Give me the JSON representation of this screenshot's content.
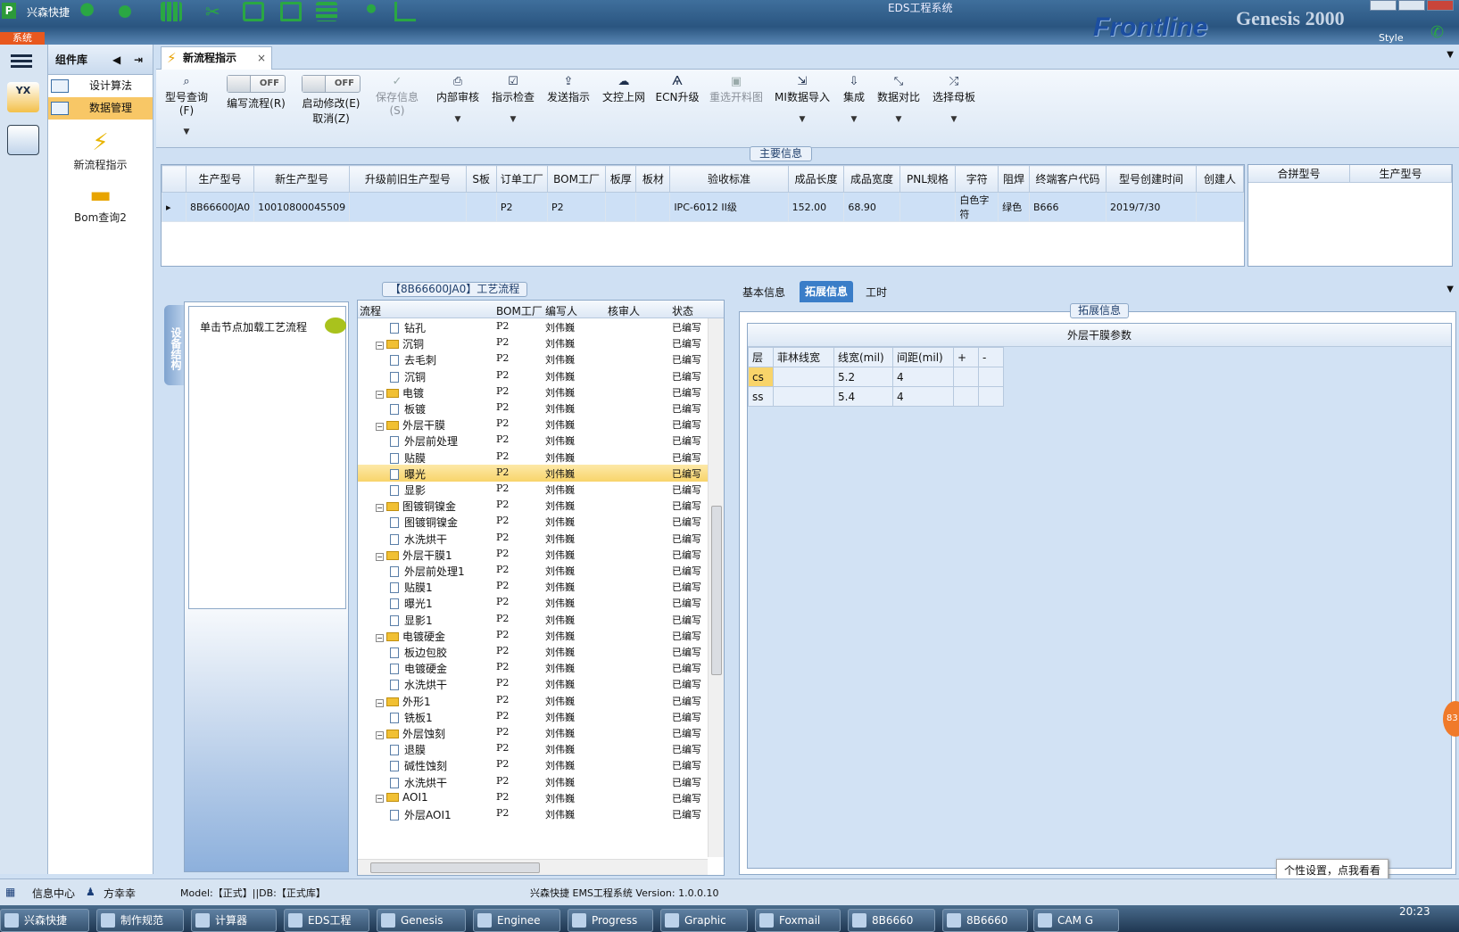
{
  "title": {
    "app_name": "兴森快捷",
    "window_title": "EDS工程系统",
    "brand": "Frontline",
    "brand2": "Genesis 2000",
    "style_label": "Style"
  },
  "system_button": "系统",
  "component_panel": {
    "header": "组件库",
    "items": [
      {
        "label": "设计算法"
      },
      {
        "label": "数据管理"
      }
    ],
    "big_items": [
      {
        "label": "新流程指示",
        "icon": "lightning-icon"
      },
      {
        "label": "Bom查询2",
        "icon": "folder-icon"
      }
    ]
  },
  "tab": {
    "label": "新流程指示"
  },
  "toolbar": {
    "items": [
      {
        "label": "型号查询(F)",
        "icon": "search-icon"
      },
      {
        "label": "编写流程(R)",
        "toggle": "OFF"
      },
      {
        "label": "启动修改(E)",
        "toggle": "OFF",
        "sub": "取消(Z)"
      },
      {
        "label": "保存信息(S)",
        "icon": "check-icon"
      },
      {
        "label": "内部审核",
        "icon": "print-icon"
      },
      {
        "label": "指示检查",
        "icon": "checkbox-icon"
      },
      {
        "label": "发送指示",
        "icon": "upload-icon"
      },
      {
        "label": "文控上网",
        "icon": "cloud-icon"
      },
      {
        "label": "ECN升级",
        "icon": "ecn-icon"
      },
      {
        "label": "重选开料图",
        "icon": "image-icon"
      },
      {
        "label": "MI数据导入",
        "icon": "import-icon"
      },
      {
        "label": "集成",
        "icon": "download-icon"
      },
      {
        "label": "数据对比",
        "icon": "compare-icon"
      },
      {
        "label": "选择母板",
        "icon": "shuffle-icon"
      }
    ]
  },
  "main_info": {
    "caption": "主要信息",
    "columns": [
      "生产型号",
      "新生产型号",
      "升级前旧生产型号",
      "S板",
      "订单工厂",
      "BOM工厂",
      "板厚",
      "板材",
      "验收标准",
      "成品长度",
      "成品宽度",
      "PNL规格",
      "字符",
      "阻焊",
      "终端客户代码",
      "型号创建时间",
      "创建人"
    ],
    "rows": [
      [
        "8B66600JA0",
        "10010800045509",
        "",
        "",
        "P2",
        "P2",
        "",
        "",
        "IPC-6012 II级",
        "152.00",
        "68.90",
        "",
        "白色字符",
        "绿色",
        "B666",
        "2019/7/30",
        ""
      ]
    ],
    "merge_columns": [
      "合拼型号",
      "生产型号"
    ]
  },
  "process": {
    "caption": "【8B66600JA0】工艺流程",
    "side_tab": "设备结构",
    "hint": "单击节点加载工艺流程",
    "columns": [
      "流程",
      "BOM工厂",
      "编写人",
      "核审人",
      "状态"
    ],
    "rows": [
      {
        "name": "钻孔",
        "level": 2,
        "bom": "P2",
        "author": "刘伟巍",
        "status": "已编写"
      },
      {
        "name": "沉铜",
        "level": 1,
        "bom": "P2",
        "author": "刘伟巍",
        "status": "已编写"
      },
      {
        "name": "去毛刺",
        "level": 2,
        "bom": "P2",
        "author": "刘伟巍",
        "status": "已编写"
      },
      {
        "name": "沉铜",
        "level": 2,
        "bom": "P2",
        "author": "刘伟巍",
        "status": "已编写"
      },
      {
        "name": "电镀",
        "level": 1,
        "bom": "P2",
        "author": "刘伟巍",
        "status": "已编写"
      },
      {
        "name": "板镀",
        "level": 2,
        "bom": "P2",
        "author": "刘伟巍",
        "status": "已编写"
      },
      {
        "name": "外层干膜",
        "level": 1,
        "bom": "P2",
        "author": "刘伟巍",
        "status": "已编写"
      },
      {
        "name": "外层前处理",
        "level": 2,
        "bom": "P2",
        "author": "刘伟巍",
        "status": "已编写"
      },
      {
        "name": "贴膜",
        "level": 2,
        "bom": "P2",
        "author": "刘伟巍",
        "status": "已编写"
      },
      {
        "name": "曝光",
        "level": 2,
        "bom": "P2",
        "author": "刘伟巍",
        "status": "已编写",
        "selected": true
      },
      {
        "name": "显影",
        "level": 2,
        "bom": "P2",
        "author": "刘伟巍",
        "status": "已编写"
      },
      {
        "name": "图镀铜镍金",
        "level": 1,
        "bom": "P2",
        "author": "刘伟巍",
        "status": "已编写"
      },
      {
        "name": "图镀铜镍金",
        "level": 2,
        "bom": "P2",
        "author": "刘伟巍",
        "status": "已编写"
      },
      {
        "name": "水洗烘干",
        "level": 2,
        "bom": "P2",
        "author": "刘伟巍",
        "status": "已编写"
      },
      {
        "name": "外层干膜1",
        "level": 1,
        "bom": "P2",
        "author": "刘伟巍",
        "status": "已编写"
      },
      {
        "name": "外层前处理1",
        "level": 2,
        "bom": "P2",
        "author": "刘伟巍",
        "status": "已编写"
      },
      {
        "name": "贴膜1",
        "level": 2,
        "bom": "P2",
        "author": "刘伟巍",
        "status": "已编写"
      },
      {
        "name": "曝光1",
        "level": 2,
        "bom": "P2",
        "author": "刘伟巍",
        "status": "已编写"
      },
      {
        "name": "显影1",
        "level": 2,
        "bom": "P2",
        "author": "刘伟巍",
        "status": "已编写"
      },
      {
        "name": "电镀硬金",
        "level": 1,
        "bom": "P2",
        "author": "刘伟巍",
        "status": "已编写"
      },
      {
        "name": "板边包胶",
        "level": 2,
        "bom": "P2",
        "author": "刘伟巍",
        "status": "已编写"
      },
      {
        "name": "电镀硬金",
        "level": 2,
        "bom": "P2",
        "author": "刘伟巍",
        "status": "已编写"
      },
      {
        "name": "水洗烘干",
        "level": 2,
        "bom": "P2",
        "author": "刘伟巍",
        "status": "已编写"
      },
      {
        "name": "外形1",
        "level": 1,
        "bom": "P2",
        "author": "刘伟巍",
        "status": "已编写"
      },
      {
        "name": "铣板1",
        "level": 2,
        "bom": "P2",
        "author": "刘伟巍",
        "status": "已编写"
      },
      {
        "name": "外层蚀刻",
        "level": 1,
        "bom": "P2",
        "author": "刘伟巍",
        "status": "已编写"
      },
      {
        "name": "退膜",
        "level": 2,
        "bom": "P2",
        "author": "刘伟巍",
        "status": "已编写"
      },
      {
        "name": "碱性蚀刻",
        "level": 2,
        "bom": "P2",
        "author": "刘伟巍",
        "status": "已编写"
      },
      {
        "name": "水洗烘干",
        "level": 2,
        "bom": "P2",
        "author": "刘伟巍",
        "status": "已编写"
      },
      {
        "name": "AOI1",
        "level": 1,
        "bom": "P2",
        "author": "刘伟巍",
        "status": "已编写"
      },
      {
        "name": "外层AOI1",
        "level": 2,
        "bom": "P2",
        "author": "刘伟巍",
        "status": "已编写"
      }
    ]
  },
  "right_panel": {
    "tabs": [
      {
        "label": "基本信息"
      },
      {
        "label": "拓展信息",
        "active": true
      },
      {
        "label": "工时"
      }
    ],
    "caption": "拓展信息",
    "param_title": "外层干膜参数",
    "param_columns": [
      "层",
      "菲林线宽",
      "线宽(mil)",
      "间距(mil)",
      "+",
      "-"
    ],
    "param_rows": [
      [
        "cs",
        "",
        "5.2",
        "4",
        "",
        ""
      ],
      [
        "ss",
        "",
        "5.4",
        "4",
        "",
        ""
      ]
    ]
  },
  "status": {
    "info_center": "信息中心",
    "user": "方幸幸",
    "model": "Model:【正式】||DB:【正式库】",
    "version": "兴森快捷 EMS工程系统 Version: 1.0.0.10"
  },
  "popup": "个性设置，点我看看",
  "taskbar": {
    "clock": "20:23",
    "tasks": [
      "兴森快捷",
      "制作规范",
      "计算器",
      "EDS工程",
      "Genesis",
      "Enginee",
      "Progress",
      "Graphic",
      "Foxmail",
      "8B6660",
      "8B6660",
      "CAM G"
    ]
  },
  "badge": "83"
}
